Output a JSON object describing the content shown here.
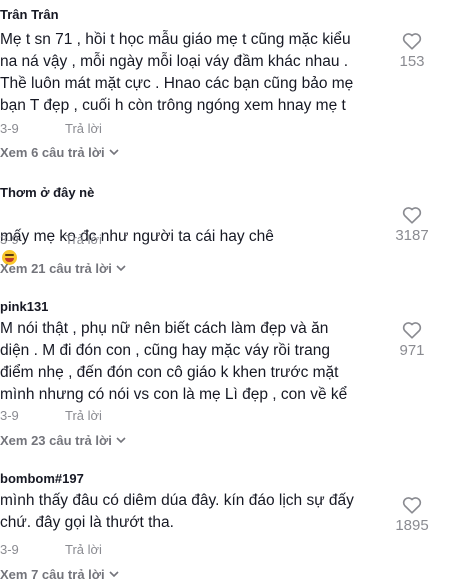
{
  "comments": [
    {
      "user": "Trân Trân",
      "text": "Mẹ t sn 71 , hồi t học mẫu giáo mẹ t cũng mặc kiểu\nna ná vậy , mỗi ngày mỗi loại váy đầm khác nhau .\nThề luôn mát mặt cực . Hnao các bạn cũng bảo mẹ\nbạn T đẹp , cuối h còn trông ngóng xem hnay mẹ t",
      "date": "3-9",
      "reply_label": "Trả lời",
      "likes": "153",
      "more_replies": "Xem 6 câu trả lời"
    },
    {
      "user": "Thơm ở đây nè",
      "text": "mấy mẹ ko đc như người ta cái hay chê",
      "emoji": "rofl-emoji",
      "date": "3-9",
      "reply_label": "Trả lời",
      "likes": "3187",
      "more_replies": "Xem 21 câu trả lời"
    },
    {
      "user": "pink131",
      "text": "M nói thật , phụ nữ nên biết cách làm đẹp và ăn\ndiện . M đi đón con , cũng hay mặc váy rồi trang\nđiểm nhẹ , đến đón con cô giáo k khen trước mặt\nmình nhưng có nói vs con là mẹ Lì đẹp , con về kể",
      "date": "3-9",
      "reply_label": "Trả lời",
      "likes": "971",
      "more_replies": "Xem 23 câu trả lời"
    },
    {
      "user": "bombom#197",
      "text": "mình thấy đâu có diêm dúa đây. kín đáo lịch sự đấy\nchứ. đây gọi là thướt tha.",
      "date": "3-9",
      "reply_label": "Trả lời",
      "likes": "1895",
      "more_replies": "Xem 7 câu trả lời"
    }
  ],
  "icons": {
    "like": "heart-outline-icon",
    "expand": "chevron-down-icon"
  },
  "colors": {
    "text": "#161823",
    "muted": "#8a8b91",
    "link": "#73747b"
  }
}
